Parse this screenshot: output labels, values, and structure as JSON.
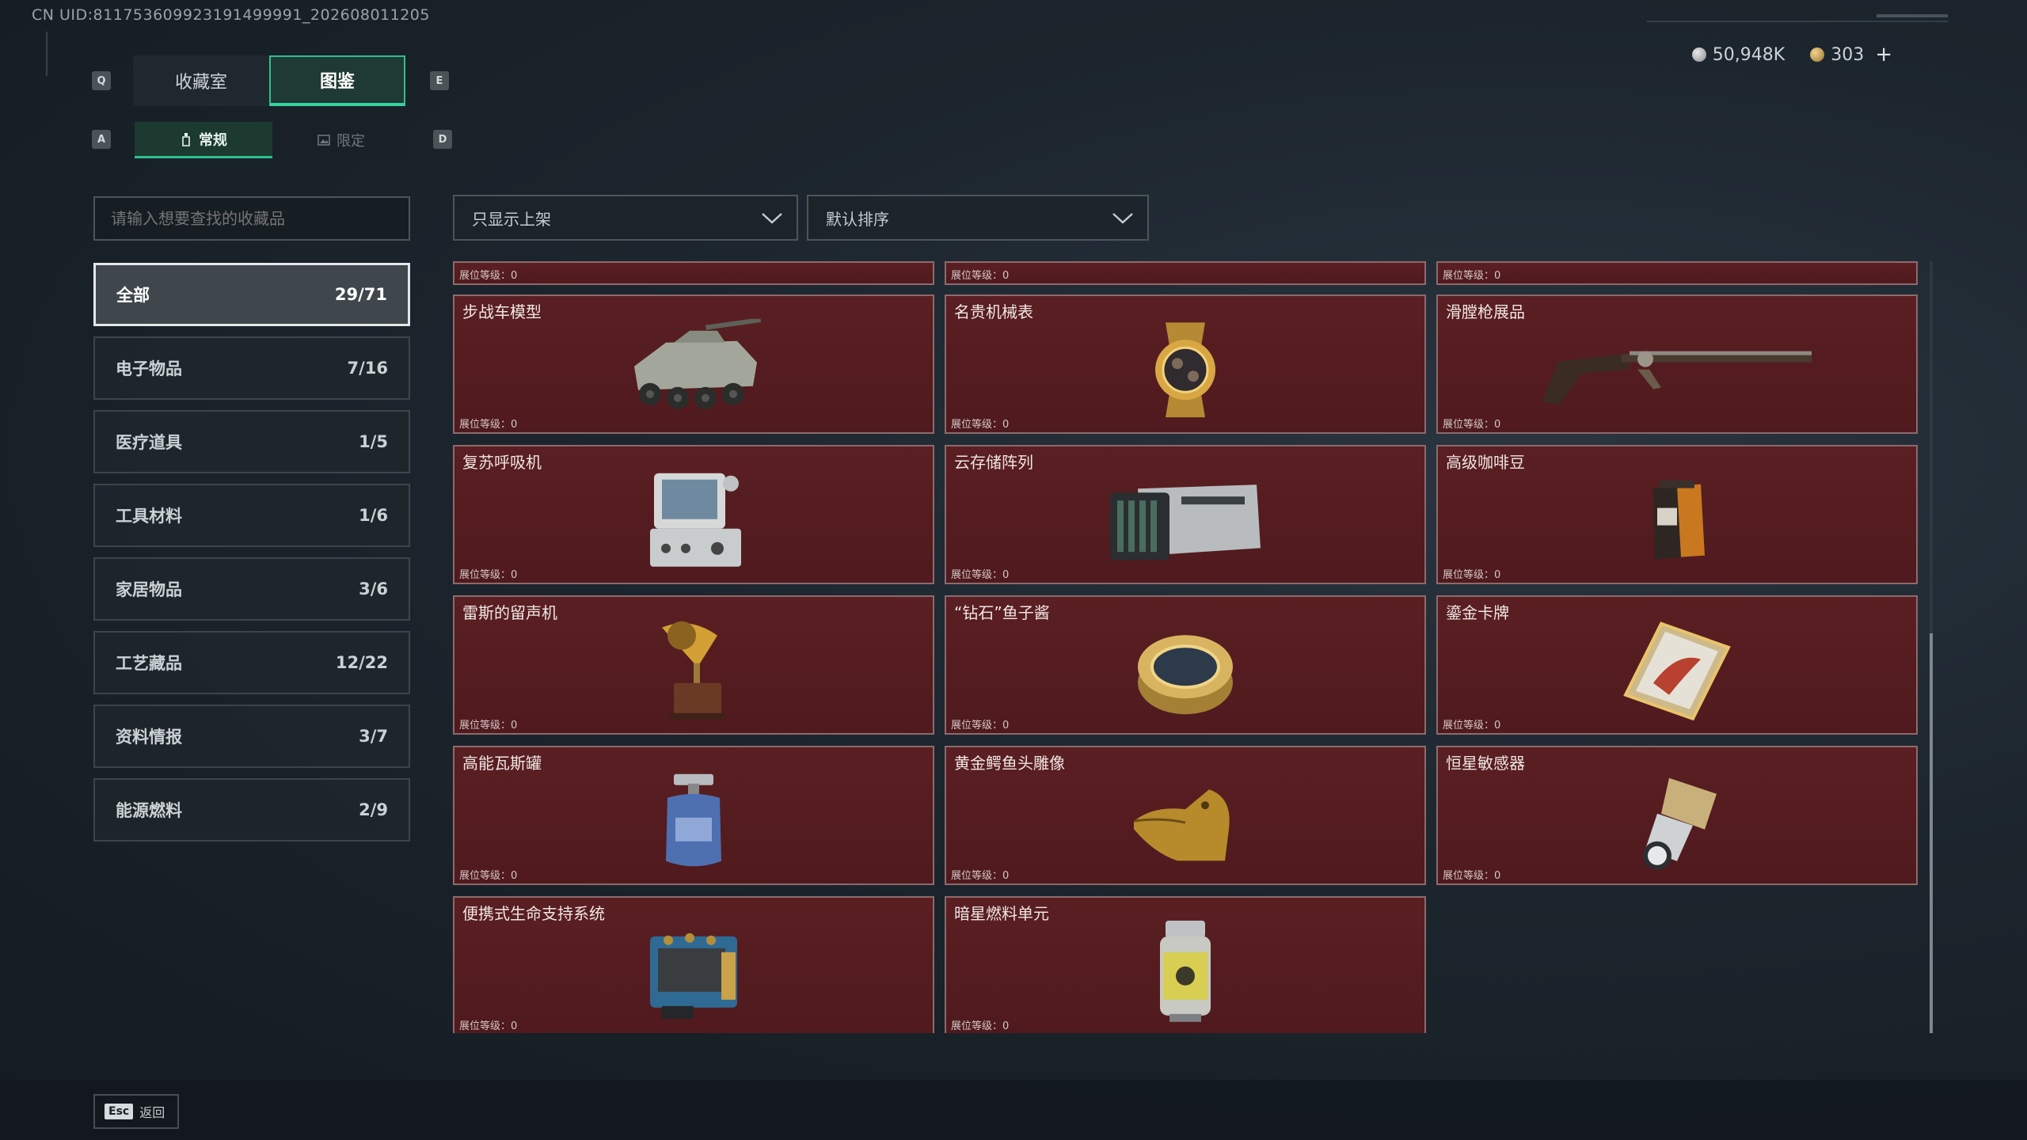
{
  "uid": "CN UID:811753609923191499991_202608011205",
  "hotkeys": {
    "tab_prev": "Q",
    "tab_next": "E",
    "sub_prev": "A",
    "sub_next": "D"
  },
  "tabs": [
    {
      "label": "收藏室"
    },
    {
      "label": "图鉴"
    }
  ],
  "subtabs": [
    {
      "label": "常规"
    },
    {
      "label": "限定"
    }
  ],
  "currency": {
    "silver": "50,948K",
    "gold": "303",
    "add": "+"
  },
  "search": {
    "placeholder": "请输入想要查找的收藏品"
  },
  "filter": {
    "value": "只显示上架"
  },
  "sort": {
    "value": "默认排序"
  },
  "categories": [
    {
      "label": "全部",
      "count": "29/71"
    },
    {
      "label": "电子物品",
      "count": "7/16"
    },
    {
      "label": "医疗道具",
      "count": "1/5"
    },
    {
      "label": "工具材料",
      "count": "1/6"
    },
    {
      "label": "家居物品",
      "count": "3/6"
    },
    {
      "label": "工艺藏品",
      "count": "12/22"
    },
    {
      "label": "资料情报",
      "count": "3/7"
    },
    {
      "label": "能源燃料",
      "count": "2/9"
    }
  ],
  "level_label": "展位等级：0",
  "items": [
    {
      "name": "步战车模型",
      "icon": "ifv-model-icon"
    },
    {
      "name": "名贵机械表",
      "icon": "watch-icon"
    },
    {
      "name": "滑膛枪展品",
      "icon": "musket-icon"
    },
    {
      "name": "复苏呼吸机",
      "icon": "ventilator-icon"
    },
    {
      "name": "云存储阵列",
      "icon": "storage-array-icon"
    },
    {
      "name": "高级咖啡豆",
      "icon": "coffee-bag-icon"
    },
    {
      "name": "雷斯的留声机",
      "icon": "gramophone-icon"
    },
    {
      "name": "“钻石”鱼子酱",
      "icon": "caviar-tin-icon"
    },
    {
      "name": "鎏金卡牌",
      "icon": "gilded-card-icon"
    },
    {
      "name": "高能瓦斯罐",
      "icon": "gas-canister-icon"
    },
    {
      "name": "黄金鳄鱼头雕像",
      "icon": "crocodile-statue-icon"
    },
    {
      "name": "恒星敏感器",
      "icon": "star-sensor-icon"
    },
    {
      "name": "便携式生命支持系统",
      "icon": "life-support-icon"
    },
    {
      "name": "暗星燃料单元",
      "icon": "fuel-cell-icon"
    }
  ],
  "footer": {
    "esc_key": "Esc",
    "back_label": "返回"
  }
}
